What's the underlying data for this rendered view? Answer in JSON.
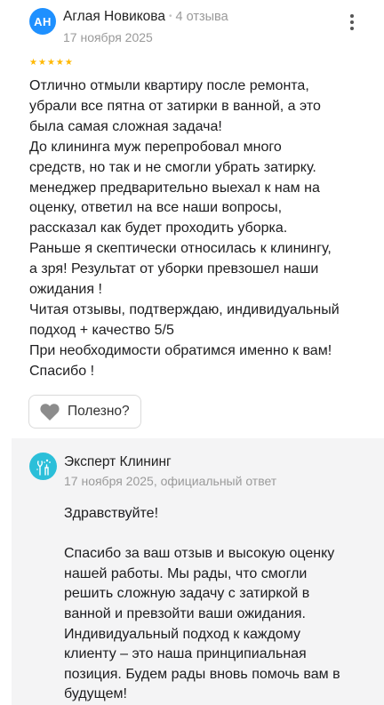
{
  "review": {
    "author": {
      "initials": "АН",
      "name": "Аглая Новикова",
      "separator": "•",
      "reviews_count": "4 отзыва",
      "avatar_color": "#1e90ff"
    },
    "date": "17 ноября 2025",
    "rating": 5,
    "star_color": "#ffb800",
    "text": "Отлично отмыли квартиру после ремонта,\nубрали все пятна от затирки в ванной, а это\nбыла самая сложная задача!\nДо клининга муж перепробовал много\nсредств, но так и не смогли убрать затирку.\nменеджер предварительно выехал к нам на\nоценку, ответил на все наши вопросы,\nрассказал как будет проходить уборка.\nРаньше я скептически относилась к клинингу,\nа зря! Результат от уборки превзошел наши\nожидания !\nЧитая отзывы, подтверждаю, индивидуальный\nподход + качество 5/5\nПри необходимости обратимся именно к вам!\nСпасибо !",
    "helpful_label": "Полезно?",
    "more_icon": "more-vertical-icon"
  },
  "reply": {
    "company": "Эксперт Клининг",
    "date": "17 ноября 2025, официальный ответ",
    "logo_color": "#2bbfd9",
    "background": "#f4f4f5",
    "text": "Здравствуйте!\n\nСпасибо за ваш отзыв и высокую оценку\nнашей работы. Мы рады, что смогли\nрешить сложную задачу с затиркой в\nванной и превзойти ваши ожидания.\nИндивидуальный подход к каждому\nклиенту – это наша принципиальная\nпозиция. Будем рады вновь помочь вам в\nбудущем!"
  }
}
